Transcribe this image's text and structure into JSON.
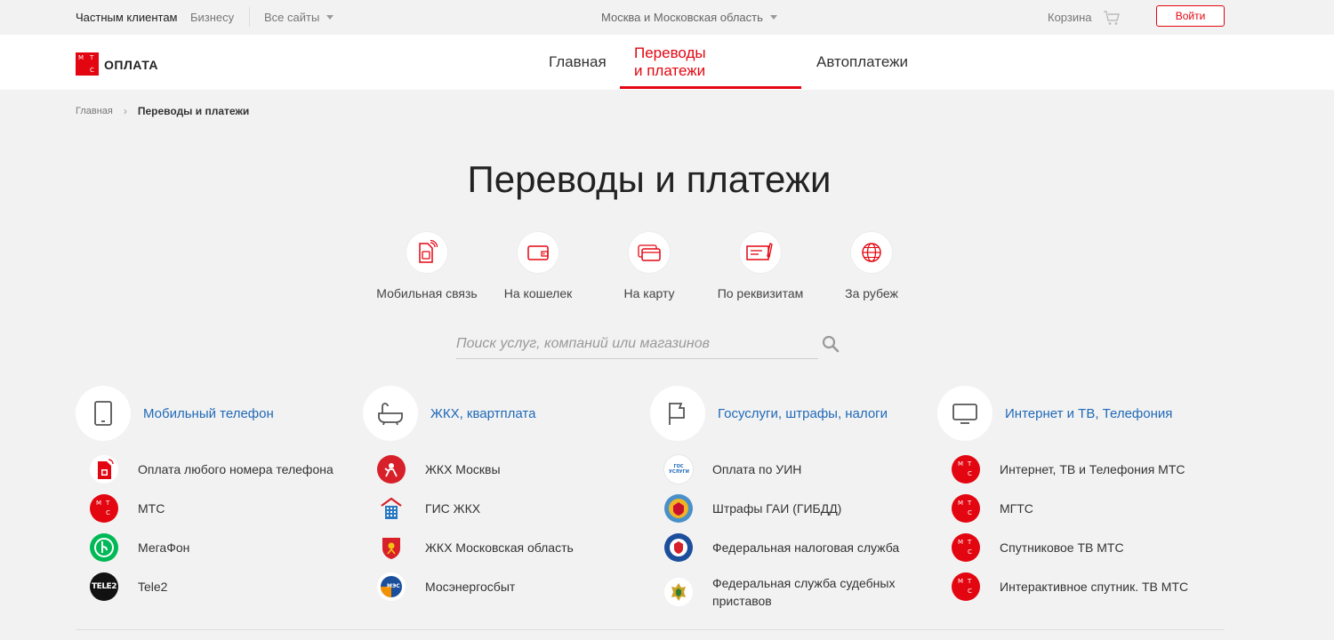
{
  "topbar": {
    "private": "Частным клиентам",
    "business": "Бизнесу",
    "all_sites": "Все сайты",
    "region": "Москва и Московская область",
    "cart": "Корзина",
    "login": "Войти"
  },
  "logo": {
    "letters": [
      "М",
      "Т",
      "С"
    ],
    "text": "ОПЛАТА"
  },
  "nav": {
    "items": [
      {
        "label": "Главная"
      },
      {
        "label": "Переводы и платежи"
      },
      {
        "label": "Автоплатежи"
      }
    ]
  },
  "breadcrumb": {
    "home": "Главная",
    "separator": "›",
    "current": "Переводы и платежи"
  },
  "title": "Переводы и платежи",
  "quick_actions": [
    {
      "label": "Мобильная связь",
      "icon": "sim-card-icon"
    },
    {
      "label": "На кошелек",
      "icon": "wallet-icon"
    },
    {
      "label": "На карту",
      "icon": "card-icon"
    },
    {
      "label": "По реквизитам",
      "icon": "requisites-icon"
    },
    {
      "label": "За рубеж",
      "icon": "globe-icon"
    }
  ],
  "search": {
    "placeholder": "Поиск услуг, компаний или магазинов"
  },
  "categories": [
    {
      "title": "Мобильный телефон",
      "icon": "phone-icon",
      "items": [
        {
          "label": "Оплата любого номера телефона",
          "icon": "sim-logo-icon"
        },
        {
          "label": "МТС",
          "icon": "mts-logo-icon"
        },
        {
          "label": "МегаФон",
          "icon": "megafon-logo-icon"
        },
        {
          "label": "Tele2",
          "icon": "tele2-logo-icon",
          "logo_text": "TELE2"
        }
      ]
    },
    {
      "title": "ЖКХ, квартплата",
      "icon": "bathtub-icon",
      "items": [
        {
          "label": "ЖКХ Москвы",
          "icon": "moscow-logo-icon"
        },
        {
          "label": "ГИС ЖКХ",
          "icon": "gis-logo-icon"
        },
        {
          "label": "ЖКХ Московская область",
          "icon": "mo-coat-icon"
        },
        {
          "label": "Мосэнергосбыт",
          "icon": "mosenergo-logo-icon",
          "logo_text": "МЭС"
        }
      ]
    },
    {
      "title": "Госуслуги, штрафы, налоги",
      "icon": "flag-icon",
      "items": [
        {
          "label": "Оплата по УИН",
          "icon": "gosuslugi-logo-icon",
          "logo_text": "ГОС УСЛУГИ"
        },
        {
          "label": "Штрафы ГАИ (ГИБДД)",
          "icon": "gibdd-logo-icon"
        },
        {
          "label": "Федеральная налоговая служба",
          "icon": "fns-logo-icon"
        },
        {
          "label": "Федеральная служба судебных приставов",
          "icon": "fssp-logo-icon"
        }
      ]
    },
    {
      "title": "Интернет и ТВ, Телефония",
      "icon": "tv-icon",
      "items": [
        {
          "label": "Интернет, ТВ и Телефония МТС",
          "icon": "mts-logo-icon"
        },
        {
          "label": "МГТС",
          "icon": "mts-logo-icon"
        },
        {
          "label": "Спутниковое ТВ МТС",
          "icon": "mts-logo-icon"
        },
        {
          "label": "Интерактивное спутник. ТВ МТС",
          "icon": "mts-logo-icon"
        }
      ]
    }
  ],
  "colors": {
    "brand_red": "#e30611",
    "link_blue": "#1f69b8",
    "background": "#f2f2f2"
  }
}
